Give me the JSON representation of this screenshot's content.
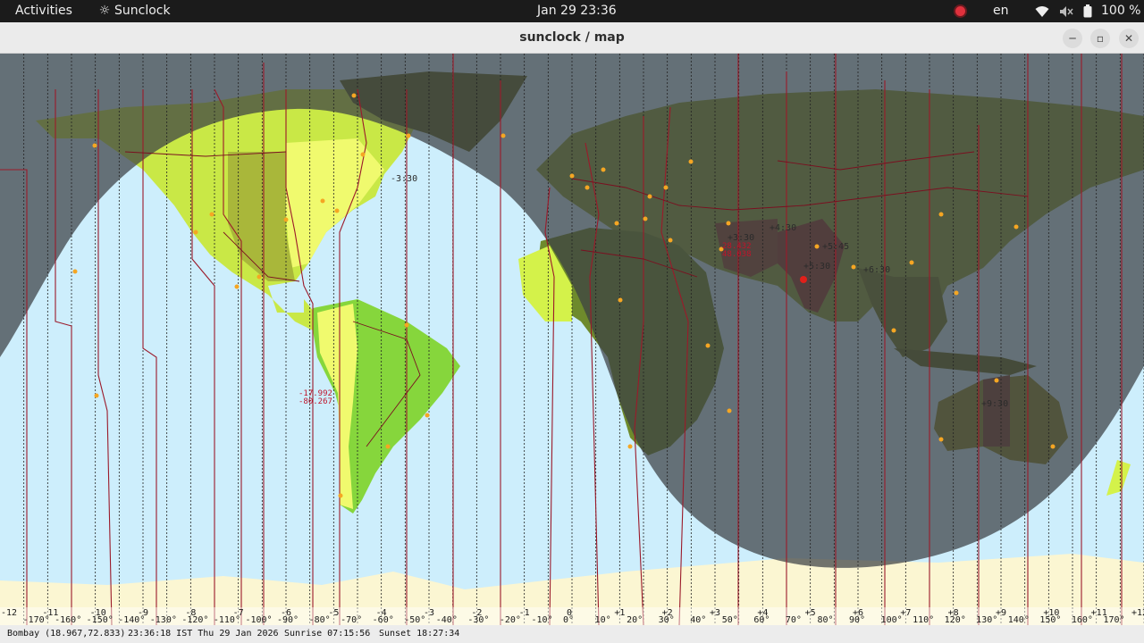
{
  "topbar": {
    "activities": "Activities",
    "app_name": "Sunclock",
    "clock": "Jan 29  23:36",
    "language": "en",
    "battery": "100 %",
    "icons": [
      "sun-icon",
      "record-indicator-icon",
      "wifi-icon",
      "volume-muted-icon",
      "battery-icon"
    ]
  },
  "window": {
    "title": "sunclock / map",
    "controls": [
      "minimize",
      "maximize",
      "close"
    ]
  },
  "map": {
    "colors": {
      "ocean_day": "#cdeefc",
      "night_shade": "#3c4044",
      "land_yellow": "#f0fa6e",
      "land_lime": "#b8ea4e",
      "land_green": "#86d63c",
      "land_brown": "#7a3a30",
      "border_red": "#9b1a2a",
      "city": "#f5a623"
    },
    "offset_markers": [
      "+3:30",
      "+4:30",
      "+5:30",
      "+5:45",
      "+6:30",
      "+9:30",
      "-3:30"
    ],
    "cursor_coords": [
      {
        "lat": "-17.992",
        "lon": "-80.267"
      },
      {
        "lat": "28.432",
        "lon": "48.038"
      }
    ],
    "timezone_offsets": [
      "-12",
      "-11",
      "-10",
      "-9",
      "-8",
      "-7",
      "-6",
      "-5",
      "-4",
      "-3",
      "-2",
      "-1",
      "0",
      "+1",
      "+2",
      "+3",
      "+4",
      "+5",
      "+6",
      "+7",
      "+8",
      "+9",
      "+10",
      "+11",
      "+12"
    ],
    "longitudes": [
      "-170°",
      "-160°",
      "-150°",
      "-140°",
      "-130°",
      "-120°",
      "-110°",
      "-100°",
      "-90°",
      "-80°",
      "-70°",
      "-60°",
      "-50°",
      "-40°",
      "-30°",
      "-20°",
      "-10°",
      "0°",
      "10°",
      "20°",
      "30°",
      "40°",
      "50°",
      "60°",
      "70°",
      "80°",
      "90°",
      "100°",
      "110°",
      "120°",
      "130°",
      "140°",
      "150°",
      "160°",
      "170°"
    ]
  },
  "status": {
    "city": "Bombay (18.967,72.833)",
    "time": "23:36:18 IST Thu 29 Jan 2026",
    "sunrise": "Sunrise 07:15:56",
    "sunset": "Sunset 18:27:34"
  }
}
